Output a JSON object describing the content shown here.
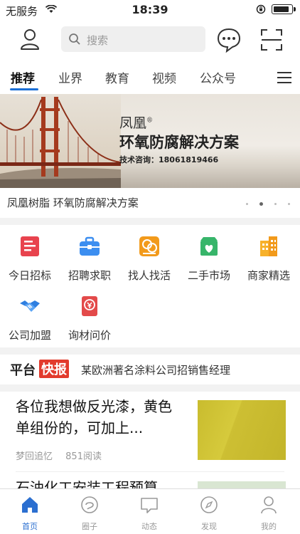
{
  "status_bar": {
    "carrier": "无服务",
    "time": "18:39"
  },
  "search": {
    "placeholder": "搜索"
  },
  "tabs": [
    {
      "label": "推荐",
      "active": true
    },
    {
      "label": "业界",
      "active": false
    },
    {
      "label": "教育",
      "active": false
    },
    {
      "label": "视频",
      "active": false
    },
    {
      "label": "公众号",
      "active": false
    }
  ],
  "banner": {
    "brand": "凤凰",
    "brand_mark": "®",
    "title": "环氧防腐解决方案",
    "contact": "技术咨询：18061819466",
    "caption": "凤凰树脂 环氧防腐解决方案",
    "slide_count": 4,
    "active_slide": 2
  },
  "categories": [
    {
      "label": "今日招标",
      "icon": "bid-icon",
      "color": "#e8434e"
    },
    {
      "label": "招聘求职",
      "icon": "briefcase-icon",
      "color": "#3c8ef0"
    },
    {
      "label": "找人找活",
      "icon": "worker-icon",
      "color": "#f29a1b"
    },
    {
      "label": "二手市场",
      "icon": "shop-icon",
      "color": "#37b56a"
    },
    {
      "label": "商家精选",
      "icon": "building-icon",
      "color": "#f7b12a"
    },
    {
      "label": "公司加盟",
      "icon": "handshake-icon",
      "color": "#2f7fe0"
    },
    {
      "label": "询材问价",
      "icon": "price-tag-icon",
      "color": "#e34a4a"
    }
  ],
  "flash": {
    "title_a": "平台",
    "title_b": "快报",
    "message": "某欧洲著名涂料公司招销售经理"
  },
  "article": {
    "title": "各位我想做反光漆，黄色单组份的，可加上...",
    "author": "梦回追忆",
    "reads": "851阅读"
  },
  "next_article": {
    "title": "石油化工安装工程预算"
  },
  "tabbar": [
    {
      "label": "首页",
      "icon": "home-icon",
      "active": true
    },
    {
      "label": "圈子",
      "icon": "circle-icon",
      "active": false
    },
    {
      "label": "动态",
      "icon": "chat-icon",
      "active": false
    },
    {
      "label": "发现",
      "icon": "compass-icon",
      "active": false
    },
    {
      "label": "我的",
      "icon": "user-icon",
      "active": false
    }
  ],
  "colors": {
    "accent": "#2b6fd0",
    "flash_red": "#e23a2c"
  }
}
